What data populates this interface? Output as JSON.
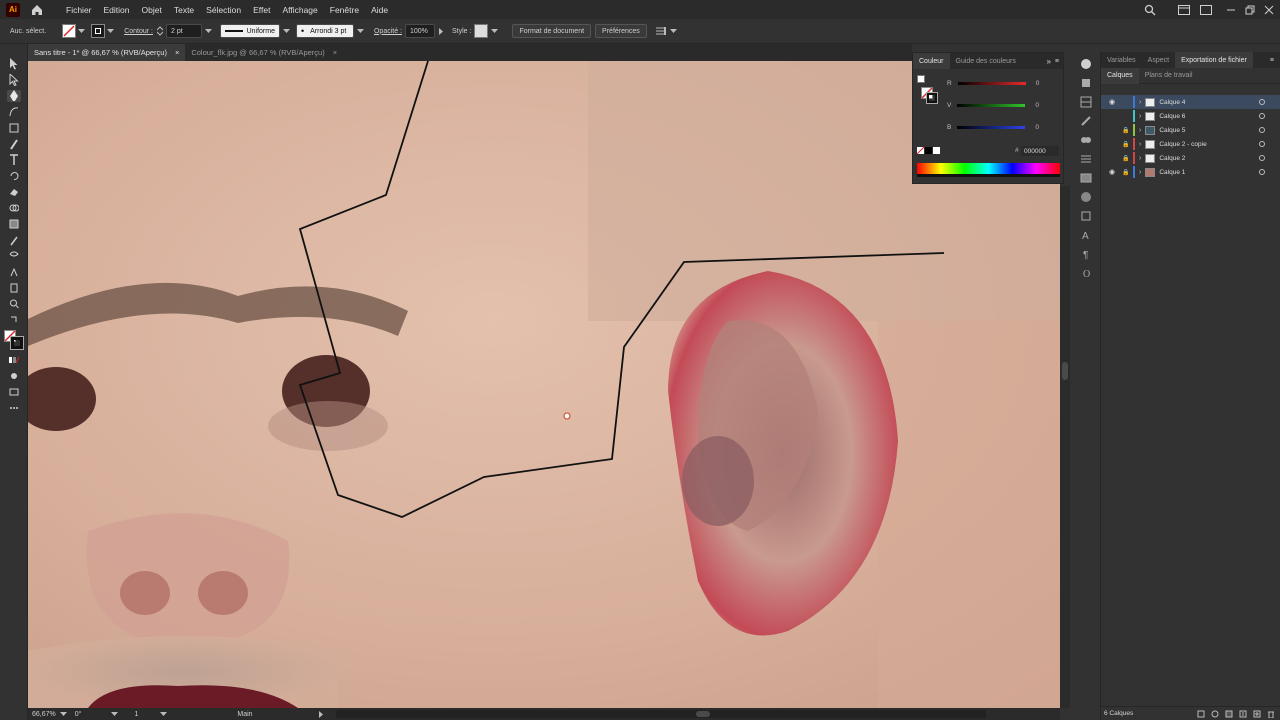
{
  "menubar": {
    "logo": "Ai",
    "menus": [
      "Fichier",
      "Edition",
      "Objet",
      "Texte",
      "Sélection",
      "Effet",
      "Affichage",
      "Fenêtre",
      "Aide"
    ]
  },
  "controlbar": {
    "selection_label": "Auc. sélect.",
    "contour_label": "Contour :",
    "stroke_weight": "2 pt",
    "profile": "Uniforme",
    "brush": "Arrondi 3 pt",
    "opacity_label": "Opacité :",
    "opacity_value": "100%",
    "style_label": "Style :",
    "doc_format_button": "Format de document",
    "preferences_button": "Préférences"
  },
  "tabs": [
    {
      "label": "Sans titre - 1* @ 66,67 % (RVB/Aperçu)",
      "close": "×"
    },
    {
      "label": "Colour_flk.jpg @ 66,67 % (RVB/Aperçu)",
      "close": "×"
    }
  ],
  "status": {
    "zoom": "66,67%",
    "angle": "0°",
    "artboard": "1",
    "tool": "Main"
  },
  "color_panel": {
    "tabs": [
      "Couleur",
      "Guide des couleurs"
    ],
    "sliders": [
      {
        "label": "R",
        "value": "0",
        "color": "#e8292c"
      },
      {
        "label": "V",
        "value": "0",
        "color": "#2dc52b"
      },
      {
        "label": "B",
        "value": "0",
        "color": "#2b43e8"
      }
    ],
    "hex_label": "#",
    "hex_value": "000000"
  },
  "layers_panel": {
    "top_tabs": [
      "Variables",
      "Aspect",
      "Exportation de fichier"
    ],
    "sub_tabs": [
      "Calques",
      "Plans de travail"
    ],
    "layers": [
      {
        "name": "Calque 4",
        "visible": true,
        "locked": false,
        "color": "#3b7bd6",
        "selected": true
      },
      {
        "name": "Calque 6",
        "visible": false,
        "locked": false,
        "color": "#3fc5c8",
        "selected": false
      },
      {
        "name": "Calque 5",
        "visible": false,
        "locked": true,
        "color": "#8fc640",
        "selected": false
      },
      {
        "name": "Calque 2 - copie",
        "visible": false,
        "locked": true,
        "color": "#d64545",
        "selected": false
      },
      {
        "name": "Calque 2",
        "visible": false,
        "locked": true,
        "color": "#d64545",
        "selected": false
      },
      {
        "name": "Calque 1",
        "visible": true,
        "locked": true,
        "color": "#3b7bd6",
        "selected": false
      }
    ],
    "count": "6 Calques"
  }
}
